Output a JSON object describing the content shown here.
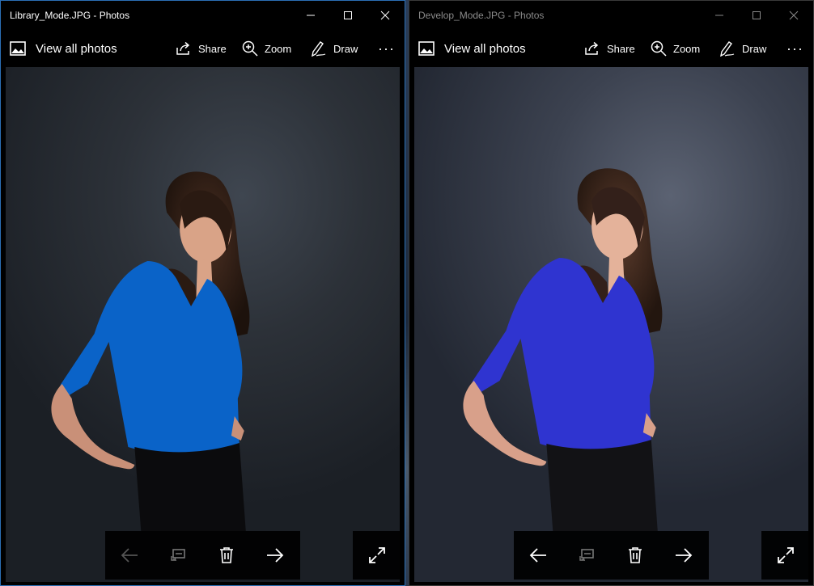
{
  "windows": [
    {
      "title": "Library_Mode.JPG - Photos",
      "active": true,
      "commands": {
        "view_all": "View all photos",
        "share": "Share",
        "zoom": "Zoom",
        "draw": "Draw",
        "more": "···"
      },
      "shirt_color": "#0a63c8",
      "prev_enabled": false
    },
    {
      "title": "Develop_Mode.JPG - Photos",
      "active": false,
      "commands": {
        "view_all": "View all photos",
        "share": "Share",
        "zoom": "Zoom",
        "draw": "Draw",
        "more": "···"
      },
      "shirt_color": "#2f34d0",
      "prev_enabled": true
    }
  ],
  "icons": {
    "photos": "photos-icon",
    "share": "share-icon",
    "zoom": "zoom-in-icon",
    "draw": "draw-pen-icon",
    "more": "more-ellipsis-icon",
    "prev": "arrow-left-icon",
    "slideshow": "slideshow-icon",
    "delete": "trash-icon",
    "next": "arrow-right-icon",
    "fullscreen": "fullscreen-expand-icon"
  }
}
